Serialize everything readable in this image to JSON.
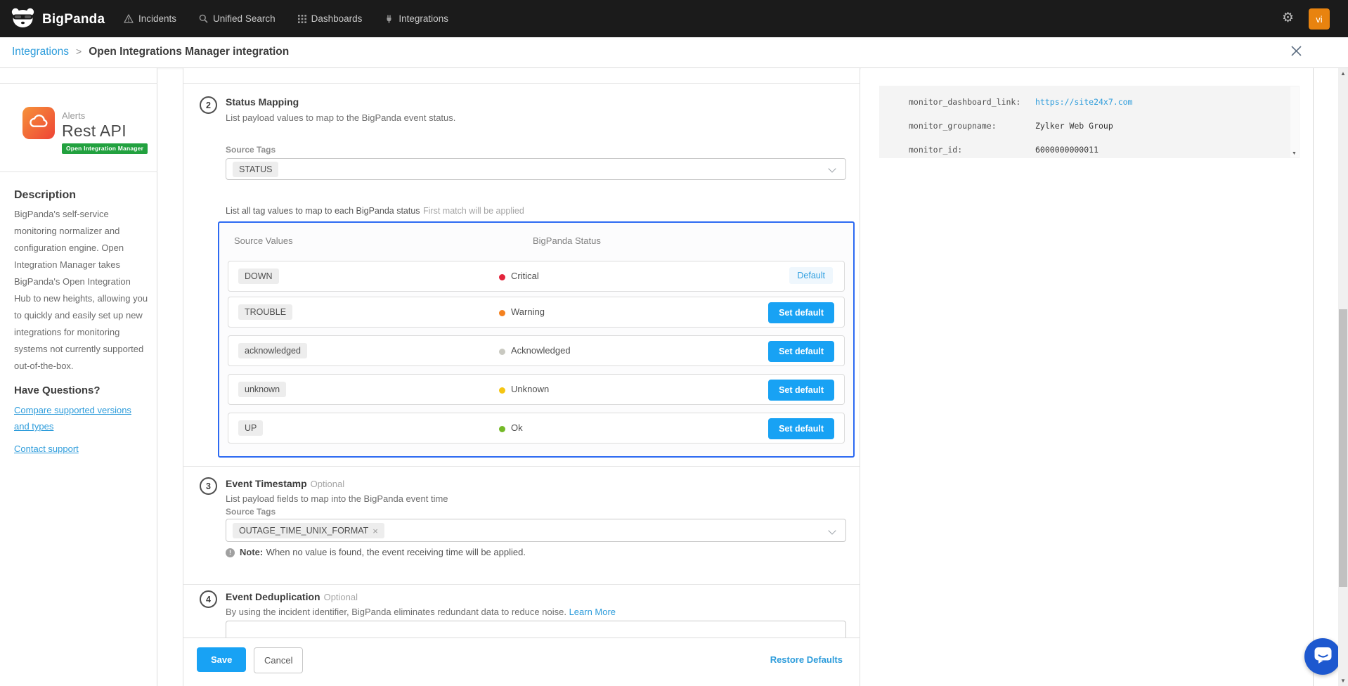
{
  "topnav": {
    "brand": "BigPanda",
    "items": [
      {
        "label": "Incidents"
      },
      {
        "label": "Unified Search"
      },
      {
        "label": "Dashboards"
      },
      {
        "label": "Integrations"
      }
    ],
    "avatar_initials": "vi"
  },
  "breadcrumb": {
    "parent": "Integrations",
    "separator": ">",
    "title": "Open Integrations Manager integration"
  },
  "sidebar": {
    "logo": {
      "line1": "Alerts",
      "line2": "Rest API",
      "badge": "Open Integration Manager"
    },
    "description_title": "Description",
    "description_body": "BigPanda's self-service monitoring normalizer and configuration engine. Open Integration Manager takes BigPanda's Open Integration Hub to new heights, allowing you to quickly and easily set up new integrations for monitoring systems not currently supported out-of-the-box.",
    "questions_title": "Have Questions?",
    "links": [
      {
        "label": "Compare supported versions and types"
      },
      {
        "label": "Contact support"
      }
    ]
  },
  "status_mapping": {
    "step": "2",
    "title": "Status Mapping",
    "subtitle": "List payload values to map to the BigPanda event status.",
    "source_tags_label": "Source Tags",
    "source_tag_value": "STATUS",
    "helper_bold": "List all tag values to map to each BigPanda status",
    "helper_gray": "First match will be applied",
    "col_source": "Source Values",
    "col_status": "BigPanda Status",
    "default_badge": "Default",
    "set_default": "Set default",
    "rows": [
      {
        "source": "DOWN",
        "status": "Critical",
        "color": "#e3243b"
      },
      {
        "source": "TROUBLE",
        "status": "Warning",
        "color": "#f4811f"
      },
      {
        "source": "acknowledged",
        "status": "Acknowledged",
        "color": "#c9c9c1"
      },
      {
        "source": "unknown",
        "status": "Unknown",
        "color": "#f5c513"
      },
      {
        "source": "UP",
        "status": "Ok",
        "color": "#74b927"
      }
    ]
  },
  "event_timestamp": {
    "step": "3",
    "title": "Event Timestamp",
    "optional": "Optional",
    "subtitle": "List payload fields to map into the BigPanda event time",
    "source_tags_label": "Source Tags",
    "tag": "OUTAGE_TIME_UNIX_FORMAT",
    "note_label": "Note:",
    "note_text": "When no value is found, the event receiving time will be applied."
  },
  "event_dedup": {
    "step": "4",
    "title": "Event Deduplication",
    "optional": "Optional",
    "subtitle": "By using the incident identifier, BigPanda eliminates redundant data to reduce noise.",
    "link": "Learn More"
  },
  "footer": {
    "save": "Save",
    "cancel": "Cancel",
    "restore": "Restore Defaults"
  },
  "payload_panel": {
    "fields": [
      {
        "key": "monitor_dashboard_link:",
        "value": "https://site24x7.com"
      },
      {
        "key": "monitor_groupname:",
        "value": "Zylker Web Group"
      },
      {
        "key": "monitor_id:",
        "value": "6000000000011"
      }
    ]
  },
  "colors": {
    "accent_button": "#18a2f4",
    "link_blue": "#2d9cdb",
    "selection_border": "#2d6af2",
    "topbar_bg": "#1b1b1b",
    "avatar_orange": "#e8830f",
    "badge_green": "#22a13f",
    "chat_blue": "#1d58cf"
  }
}
